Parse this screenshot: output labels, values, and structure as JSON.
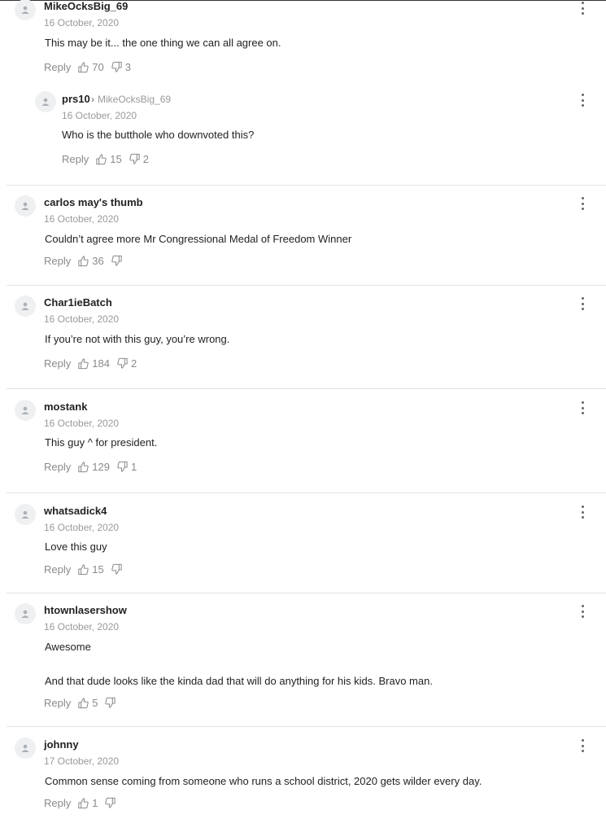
{
  "comments": [
    {
      "author": "MikeOcksBig_69",
      "date": "16 October, 2020",
      "lines": [
        "This may be it... the one thing we can all agree on."
      ],
      "reply_label": "Reply",
      "likes": "70",
      "dislikes": "3"
    },
    {
      "author": "prs10",
      "reply_to": "MikeOcksBig_69",
      "date": "16 October, 2020",
      "lines": [
        "Who is the butthole who downvoted this?"
      ],
      "reply_label": "Reply",
      "likes": "15",
      "dislikes": "2"
    },
    {
      "author": "carlos may's thumb",
      "date": "16 October, 2020",
      "lines": [
        "Couldn’t agree more Mr Congressional Medal of Freedom Winner"
      ],
      "reply_label": "Reply",
      "likes": "36",
      "dislikes": ""
    },
    {
      "author": "Char1ieBatch",
      "date": "16 October, 2020",
      "lines": [
        "If you’re not with this guy, you’re wrong."
      ],
      "reply_label": "Reply",
      "likes": "184",
      "dislikes": "2"
    },
    {
      "author": "mostank",
      "date": "16 October, 2020",
      "lines": [
        "This guy ^ for president."
      ],
      "reply_label": "Reply",
      "likes": "129",
      "dislikes": "1"
    },
    {
      "author": "whatsadick4",
      "date": "16 October, 2020",
      "lines": [
        "Love this guy"
      ],
      "reply_label": "Reply",
      "likes": "15",
      "dislikes": ""
    },
    {
      "author": "htownlasershow",
      "date": "16 October, 2020",
      "lines": [
        "Awesome",
        "And that dude looks like the kinda dad that will do anything for his kids. Bravo man."
      ],
      "reply_label": "Reply",
      "likes": "5",
      "dislikes": ""
    },
    {
      "author": "johnny",
      "date": "17 October, 2020",
      "lines": [
        "Common sense coming from someone who runs a school district, 2020 gets wilder every day."
      ],
      "reply_label": "Reply",
      "likes": "1",
      "dislikes": ""
    }
  ]
}
